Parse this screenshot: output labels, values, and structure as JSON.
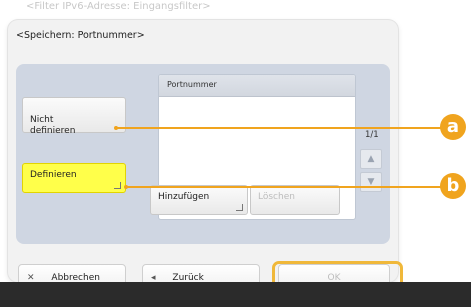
{
  "background_title": "<Filter IPv6-Adresse: Eingangsfilter>",
  "dialog": {
    "title": "<Speichern: Portnummer>",
    "left_buttons": {
      "not_define": "Nicht\ndefinieren",
      "define": "Definieren"
    },
    "list": {
      "header": "Portnummer",
      "page": "1/1"
    },
    "actions": {
      "add": "Hinzufügen",
      "delete": "Löschen"
    },
    "footer": {
      "cancel": "Abbrechen",
      "back": "Zurück",
      "ok": "OK"
    }
  },
  "callouts": {
    "a": "a",
    "b": "b"
  },
  "colors": {
    "selected": "#ffff4a",
    "callout": "#f0a41e",
    "ok_ring": "#f0b83a"
  }
}
